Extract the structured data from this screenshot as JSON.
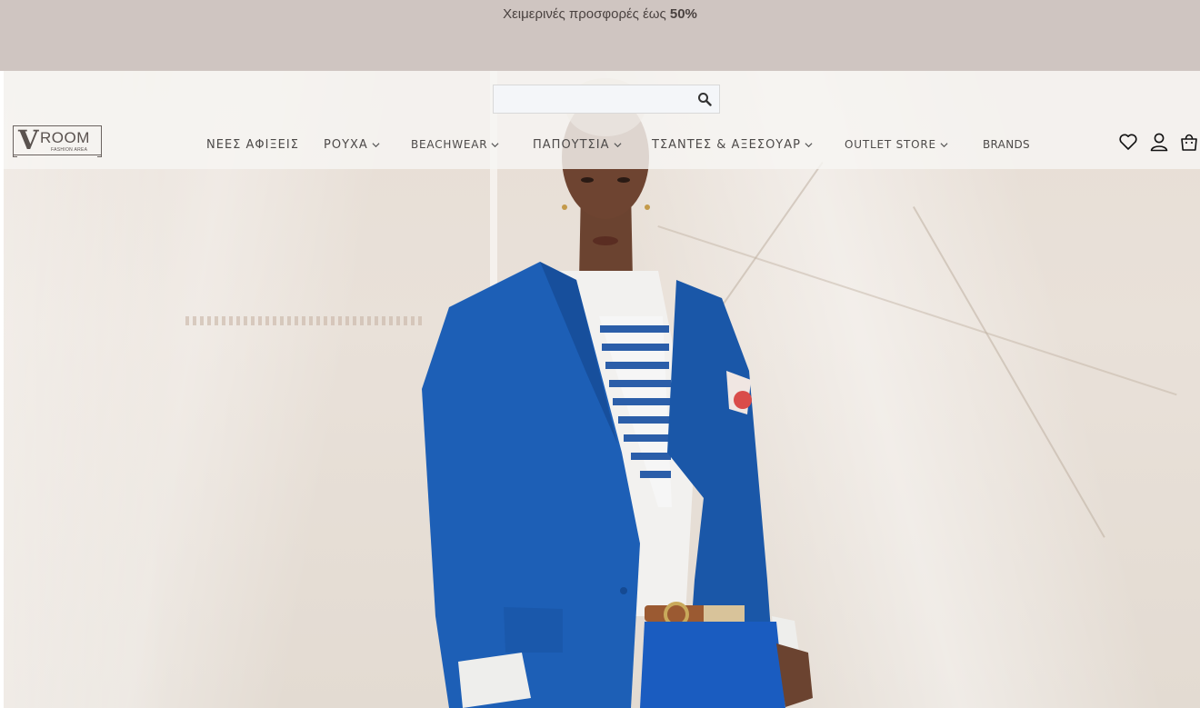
{
  "promo": {
    "text": "Χειμερινές προσφορές έως ",
    "highlight": "50%"
  },
  "search": {
    "placeholder": "",
    "value": ""
  },
  "logo": {
    "letter": "V",
    "word": "ROOM",
    "tagline": "FASHION AREA"
  },
  "nav": [
    {
      "label": "ΝΕΕΣ ΑΦΙΞΕΙΣ",
      "dropdown": false
    },
    {
      "label": "ΡΟΥΧΑ",
      "dropdown": true
    },
    {
      "label": "BEACHWEAR",
      "dropdown": true
    },
    {
      "label": "ΠΑΠΟΥΤΣΙΑ",
      "dropdown": true
    },
    {
      "label": "ΤΣΑΝΤΕΣ & ΑΞΕΣΟΥΑΡ",
      "dropdown": true
    },
    {
      "label": "OUTLET STORE",
      "dropdown": true
    },
    {
      "label": "BRANDS",
      "dropdown": false
    }
  ],
  "icons": {
    "search": "search-icon",
    "wishlist": "heart-icon",
    "account": "user-icon",
    "cart": "shopping-bag-icon"
  },
  "colors": {
    "promo_bg": "#cfc5c1",
    "text": "#4d4a49",
    "jacket": "#1c5cb4"
  }
}
